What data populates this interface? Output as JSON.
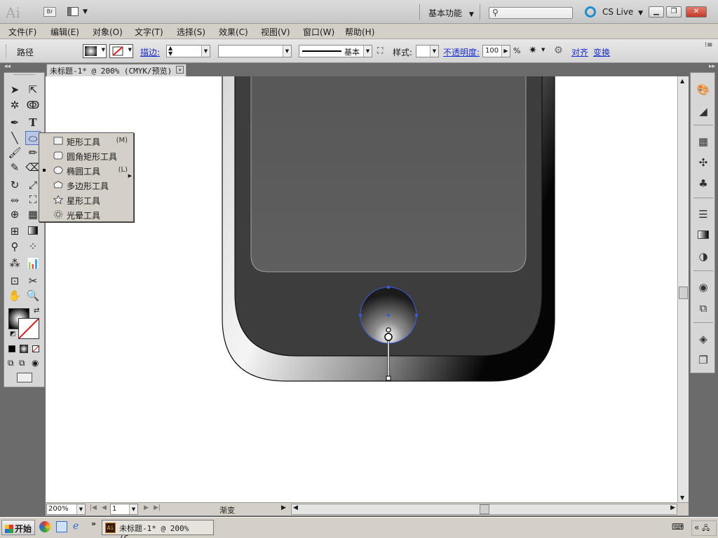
{
  "app": {
    "logo": "Ai",
    "bridge": "Br",
    "workspace": "基本功能",
    "cs_live": "CS Live",
    "search_placeholder": ""
  },
  "menu": [
    "文件(F)",
    "编辑(E)",
    "对象(O)",
    "文字(T)",
    "选择(S)",
    "效果(C)",
    "视图(V)",
    "窗口(W)",
    "帮助(H)"
  ],
  "control": {
    "selection_label": "路径",
    "stroke_link": "描边:",
    "stroke_style": "基本",
    "style_label": "样式:",
    "opacity_link": "不透明度:",
    "opacity_value": "100",
    "opacity_unit": "%",
    "align_link": "对齐",
    "transform_link": "变换"
  },
  "document": {
    "tab_title": "未标题-1* @ 200% (CMYK/预览)",
    "zoom": "200%",
    "artboard": "1",
    "status": "渐变"
  },
  "flyout": [
    {
      "label": "矩形工具",
      "key": "(M)",
      "icon": "rectangle-icon"
    },
    {
      "label": "圆角矩形工具",
      "key": "",
      "icon": "rounded-rectangle-icon"
    },
    {
      "label": "椭圆工具",
      "key": "(L)",
      "icon": "ellipse-icon",
      "selected": true
    },
    {
      "label": "多边形工具",
      "key": "",
      "icon": "polygon-icon"
    },
    {
      "label": "星形工具",
      "key": "",
      "icon": "star-icon"
    },
    {
      "label": "光晕工具",
      "key": "",
      "icon": "flare-icon"
    }
  ],
  "taskbar": {
    "start": "开始",
    "item": "未标题-1* @ 200% (C..."
  },
  "colors": {
    "selection": "#3a5bd8",
    "link": "#1b2fd0"
  }
}
